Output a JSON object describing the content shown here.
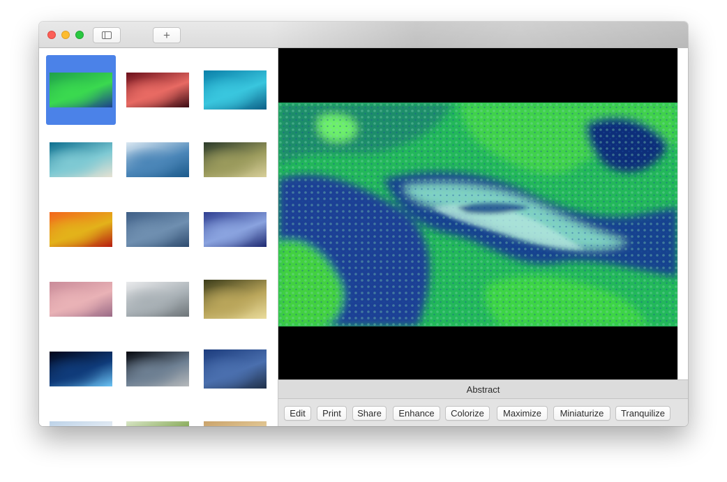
{
  "window": {
    "traffic_lights": [
      "close",
      "minimize",
      "zoom"
    ],
    "toolbar": {
      "sidebar_toggle_icon": "sidebar-icon",
      "new_tab_icon": "plus-icon",
      "new_tab_label": "+"
    }
  },
  "gallery": {
    "selected_index": 0,
    "items": [
      {
        "name": "abstract-green",
        "colors": [
          "#1fa04a",
          "#3ad94f",
          "#1c3f8c"
        ]
      },
      {
        "name": "red-canyon",
        "colors": [
          "#6b0f1a",
          "#e86a63",
          "#3a0a12"
        ]
      },
      {
        "name": "turquoise-water",
        "colors": [
          "#0a7fa8",
          "#39c6de",
          "#0b5f86"
        ]
      },
      {
        "name": "beach-shore",
        "colors": [
          "#0d6f8f",
          "#7ec9d3",
          "#e7e2d3"
        ]
      },
      {
        "name": "blue-forest",
        "colors": [
          "#dbe8f2",
          "#4b86b8",
          "#1c5a8b"
        ]
      },
      {
        "name": "grass-field",
        "colors": [
          "#2b3a2a",
          "#9a9a5c",
          "#d8cf9a"
        ]
      },
      {
        "name": "orange-painting",
        "colors": [
          "#f3661c",
          "#e3b21a",
          "#b61b10"
        ]
      },
      {
        "name": "blue-ripples",
        "colors": [
          "#3f5f86",
          "#6f8fb0",
          "#2e4b6e"
        ]
      },
      {
        "name": "blue-ice",
        "colors": [
          "#2f3f91",
          "#8aa3df",
          "#1d2870"
        ]
      },
      {
        "name": "pink-sand",
        "colors": [
          "#c98b99",
          "#e9b2b6",
          "#9a6a86"
        ]
      },
      {
        "name": "foggy-lake",
        "colors": [
          "#e9eaec",
          "#a9b1b6",
          "#6d7478"
        ]
      },
      {
        "name": "golden-cliff",
        "colors": [
          "#3a3b19",
          "#b9a55a",
          "#eadc9c"
        ]
      },
      {
        "name": "earth-moon",
        "colors": [
          "#02061a",
          "#0f3b7a",
          "#6cc4f5"
        ]
      },
      {
        "name": "earth-surface",
        "colors": [
          "#05070d",
          "#6d7f92",
          "#b6b9bb"
        ]
      },
      {
        "name": "mountain-night",
        "colors": [
          "#1c3c7d",
          "#4a6fae",
          "#203049"
        ]
      },
      {
        "name": "sky-clouds",
        "colors": [
          "#bcd2e8",
          "#e8eef5",
          "#9db8d3"
        ]
      },
      {
        "name": "green-tree",
        "colors": [
          "#d9e6c8",
          "#7da24a",
          "#c7d7b0"
        ]
      },
      {
        "name": "desert-dune",
        "colors": [
          "#c9a26a",
          "#e5cc9a",
          "#a97f48"
        ]
      }
    ]
  },
  "preview": {
    "caption": "Abstract"
  },
  "actions": [
    "Edit",
    "Print",
    "Share",
    "Enhance",
    "Colorize",
    "Maximize",
    "Miniaturize",
    "Tranquilize"
  ]
}
